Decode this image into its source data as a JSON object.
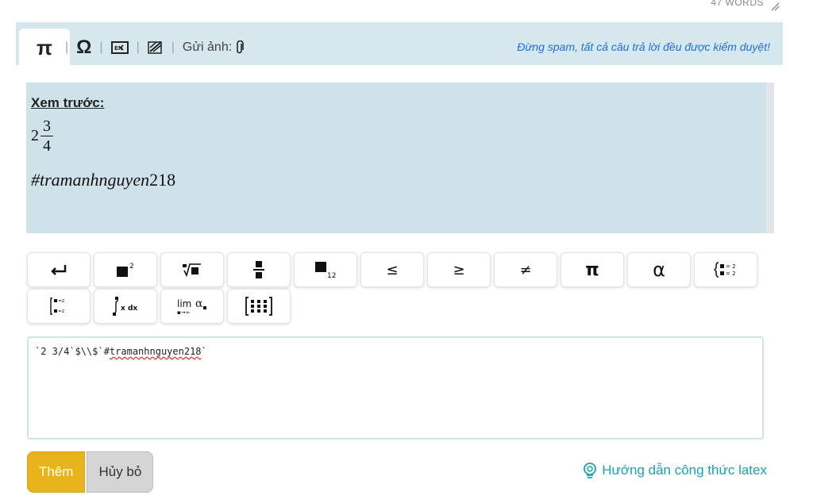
{
  "header": {
    "word_count": "47 WORDS"
  },
  "toolbar": {
    "pi_symbol": "π",
    "omega_symbol": "Ω",
    "keyboard_label": "EN",
    "send_image_label": "Gửi ảnh:",
    "spam_warning": "Đừng spam, tất cả câu trả lời đều được kiểm duyệt!"
  },
  "preview": {
    "title": "Xem trước:",
    "whole": "2",
    "numerator": "3",
    "denominator": "4",
    "tag_hash": "#",
    "tag_word": "tramanhnguyen",
    "tag_number": "218"
  },
  "math_buttons": {
    "row1": [
      "enter-icon",
      "superscript-icon",
      "nth-root-icon",
      "fraction-icon",
      "subscript-icon",
      "≤",
      "≥",
      "≠",
      "π",
      "α",
      "cases-icon"
    ],
    "row2": [
      "piecewise-icon",
      "integral-icon",
      "limit-icon",
      "matrix-icon"
    ],
    "labels": {
      "le": "≤",
      "ge": "≥",
      "ne": "≠",
      "pi": "π",
      "alpha": "α"
    }
  },
  "editor": {
    "prefix": "`2 3/4`$\\\\$`#",
    "username": "tramanhnguyen218",
    "suffix": "`"
  },
  "actions": {
    "submit_label": "Thêm",
    "cancel_label": "Hủy bỏ",
    "help_label": "Hướng dẫn công thức latex"
  },
  "colors": {
    "accent": "#e7b41b",
    "link": "#1e6fd8",
    "help": "#19a0b6",
    "frame": "#cfe3ea"
  }
}
